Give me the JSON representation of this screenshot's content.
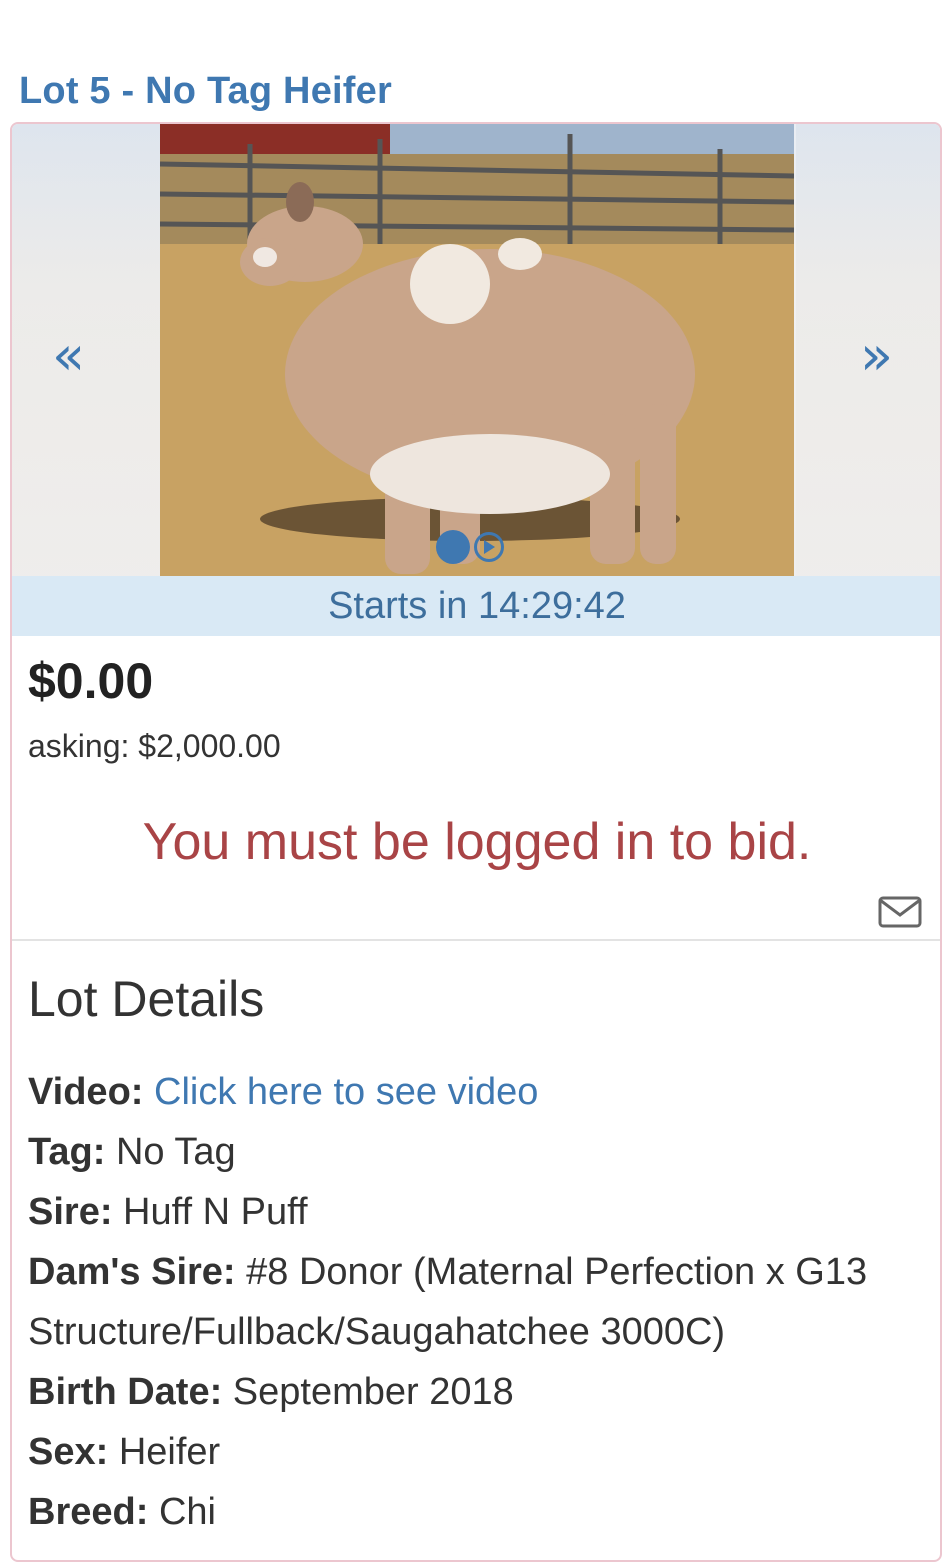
{
  "lot": {
    "title": "Lot 5 - No Tag Heifer",
    "countdown": "Starts in 14:29:42",
    "current_price": "$0.00",
    "asking": "asking: $2,000.00",
    "login_message": "You must be logged in to bid.",
    "gallery": {
      "prev_label": "«",
      "next_label": "»"
    }
  },
  "details": {
    "heading": "Lot Details",
    "rows": [
      {
        "key": "Video:",
        "value": "Click here to see video",
        "is_link": true
      },
      {
        "key": "Tag:",
        "value": "No Tag"
      },
      {
        "key": "Sire:",
        "value": "Huff N Puff"
      },
      {
        "key": "Dam's Sire:",
        "value": "#8 Donor (Maternal Perfection x G13 Structure/Fullback/Saugahatchee 3000C)"
      },
      {
        "key": "Birth Date:",
        "value": "September 2018"
      },
      {
        "key": "Sex:",
        "value": "Heifer"
      },
      {
        "key": "Breed:",
        "value": "Chi"
      }
    ]
  },
  "icons": {
    "mail": "envelope-icon",
    "play": "play-icon"
  },
  "colors": {
    "accent": "#3f78b1",
    "countdown_bg": "#d9e9f5",
    "warning": "#a94446",
    "panel_border": "#ecc6cf"
  }
}
